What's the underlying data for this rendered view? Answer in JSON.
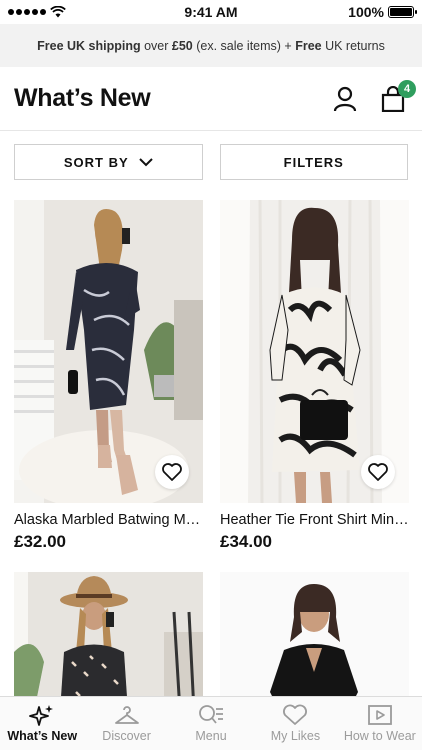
{
  "status_bar": {
    "time": "9:41 AM",
    "battery": "100%"
  },
  "promo": {
    "part1": "Free UK shipping",
    "part2": " over ",
    "part3": "£50",
    "part4": " (ex. sale items) + ",
    "part5": "Free",
    "part6": " UK returns"
  },
  "header": {
    "title": "What’s New",
    "bag_count": "4"
  },
  "controls": {
    "sort_label": "SORT BY",
    "filters_label": "FILTERS"
  },
  "products": [
    {
      "name": "Alaska Marbled Batwing Midi Dress",
      "price": "£32.00"
    },
    {
      "name": "Heather Tie Front Shirt Mini Dress",
      "price": "£34.00"
    }
  ],
  "tabs": [
    {
      "label": "What’s New",
      "icon": "sparkle-icon",
      "active": true
    },
    {
      "label": "Discover",
      "icon": "hanger-icon",
      "active": false
    },
    {
      "label": "Menu",
      "icon": "search-menu-icon",
      "active": false
    },
    {
      "label": "My Likes",
      "icon": "heart-icon",
      "active": false
    },
    {
      "label": "How to Wear",
      "icon": "play-icon",
      "active": false
    }
  ],
  "colors": {
    "badge": "#2f9e5e",
    "promo_bg": "#f2f2f2"
  }
}
